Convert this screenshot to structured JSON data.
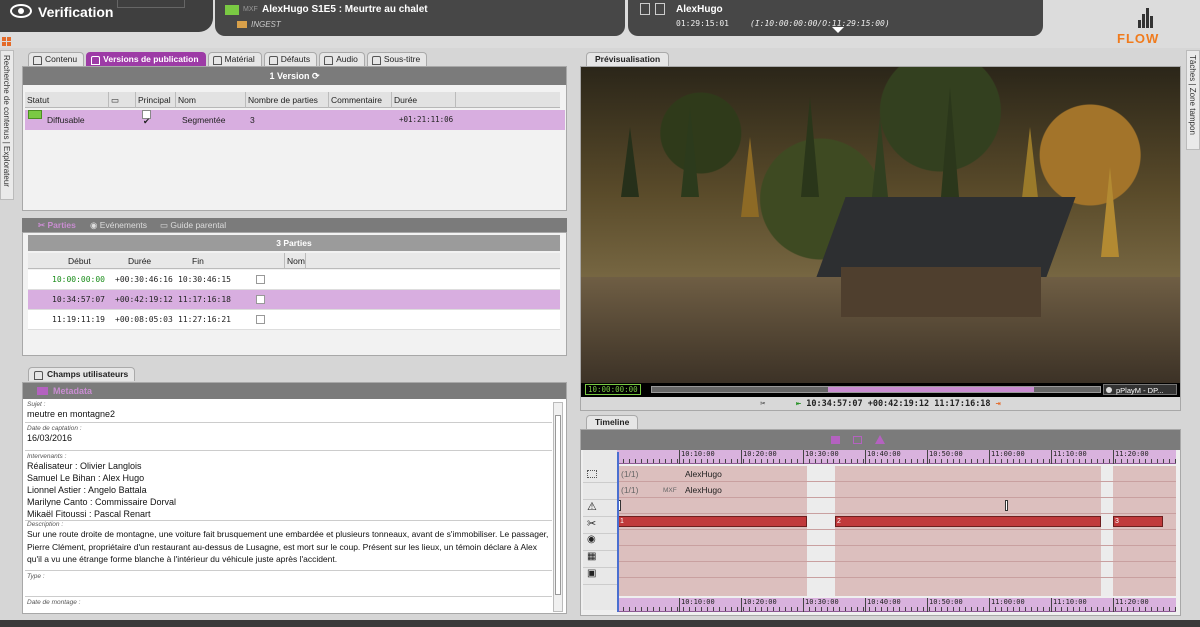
{
  "header": {
    "app_title": "Verification",
    "program": {
      "mxf": "MXF",
      "title": "AlexHugo S1E5 : Meurtre au chalet",
      "folder": "INGEST"
    },
    "asset": {
      "title": "AlexHugo",
      "timecode": "01:29:15:01",
      "inout": "(I:10:00:00:00/O:11:29:15:00)"
    },
    "logo": "FLOW"
  },
  "side_tabs": {
    "left": "Recherche de contenus | Explorateur",
    "right": "Tâches | Zone tampon"
  },
  "tabs": [
    {
      "label": "Contenu",
      "active": false
    },
    {
      "label": "Versions de publication",
      "active": true
    },
    {
      "label": "Matérial",
      "active": false
    },
    {
      "label": "Défauts",
      "active": false
    },
    {
      "label": "Audio",
      "active": false
    },
    {
      "label": "Sous-titre",
      "active": false
    }
  ],
  "versions": {
    "header": "1 Version",
    "columns": [
      "Statut",
      "",
      "Principal",
      "Nom",
      "Nombre de parties",
      "Commentaire",
      "Durée"
    ],
    "rows": [
      {
        "statut": "Diffusable",
        "principal_check": "✔",
        "nom": "Segmentée",
        "parties": "3",
        "commentaire": "",
        "duree": "+01:21:11:06"
      }
    ]
  },
  "parts_tabs": [
    {
      "label": "Parties",
      "active": true
    },
    {
      "label": "Evénements",
      "active": false
    },
    {
      "label": "Guide parental",
      "active": false
    }
  ],
  "parts": {
    "header": "3 Parties",
    "columns": [
      "Début",
      "Durée",
      "Fin",
      "Nom"
    ],
    "rows": [
      {
        "debut": "10:00:00:00",
        "duree": "+00:30:46:16",
        "fin": "10:30:46:15",
        "selected": false
      },
      {
        "debut": "10:34:57:07",
        "duree": "+00:42:19:12",
        "fin": "11:17:16:18",
        "selected": true
      },
      {
        "debut": "11:19:11:19",
        "duree": "+00:08:05:03",
        "fin": "11:27:16:21",
        "selected": false
      }
    ]
  },
  "champs": {
    "tab_label": "Champs utilisateurs",
    "section": "Metadata",
    "fields": {
      "sujet_label": "Sujet :",
      "sujet": "meutre en montagne2",
      "date_label": "Date de captation :",
      "date": "16/03/2016",
      "intervenants_label": "Intervenants :",
      "intervenants": [
        "Réalisateur : Olivier Langlois",
        "Samuel Le Bihan : Alex Hugo",
        "Lionnel Astier : Angelo Battala",
        "Marilyne Canto : Commissaire Dorval",
        "Mikaël Fitoussi : Pascal Renart"
      ],
      "description_label": "Description :",
      "description": "Sur une route droite de montagne, une voiture fait brusquement une embardée et plusieurs tonneaux, avant de s'immobiliser. Le passager, Pierre Clément, propriétaire d'un restaurant au-dessus de Lusagne, est mort sur le coup. Présent sur les lieux, un témoin déclare à Alex qu'il a vu une étrange forme blanche à l'intérieur du véhicule juste après l'accident.",
      "type_label": "Type :",
      "montage_label": "Date de montage :"
    }
  },
  "preview": {
    "tab_label": "Prévisualisation",
    "timecode": "10:00:00:00",
    "player": "pPlayM - DP...",
    "in": "10:34:57:07",
    "duration": "+00:42:19:12",
    "out": "11:17:16:18"
  },
  "timeline": {
    "tab_label": "Timeline",
    "ticks": [
      "10:10:00",
      "10:20:00",
      "10:30:00",
      "10:40:00",
      "10:50:00",
      "11:00:00",
      "11:10:00",
      "11:20:00"
    ],
    "lanes": [
      {
        "prefix": "(1/1)",
        "label": "AlexHugo"
      },
      {
        "prefix": "(1/1)",
        "mxf": "MXF",
        "label": "AlexHugo"
      }
    ],
    "segments": [
      "1",
      "2",
      "3"
    ],
    "colors": {
      "accent": "#9d3ba6",
      "segment": "#c0393b",
      "lane_bg": "#dcbfbe"
    }
  }
}
